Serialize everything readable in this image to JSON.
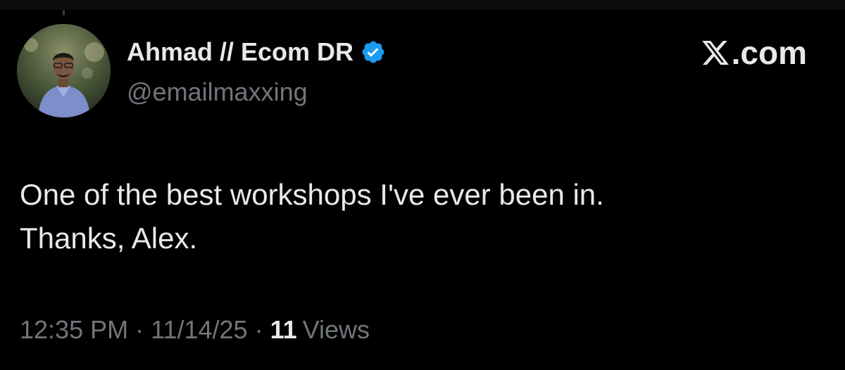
{
  "author": {
    "display_name": "Ahmad // Ecom DR",
    "handle": "@emailmaxxing",
    "verified": true,
    "verified_color": "#1d9bf0",
    "avatar_icon": "profile-photo"
  },
  "brand": {
    "label": ".com",
    "icon": "x-logo-icon"
  },
  "tweet": {
    "lines": [
      "One of the best workshops I've ever been in.",
      "Thanks, Alex."
    ]
  },
  "meta": {
    "time": "12:35 PM",
    "separator": "·",
    "date": "11/14/25",
    "views_count": "11",
    "views_label": "Views"
  },
  "colors": {
    "background": "#000000",
    "primary_text": "#e7e9ea",
    "secondary_text": "#71767b"
  }
}
